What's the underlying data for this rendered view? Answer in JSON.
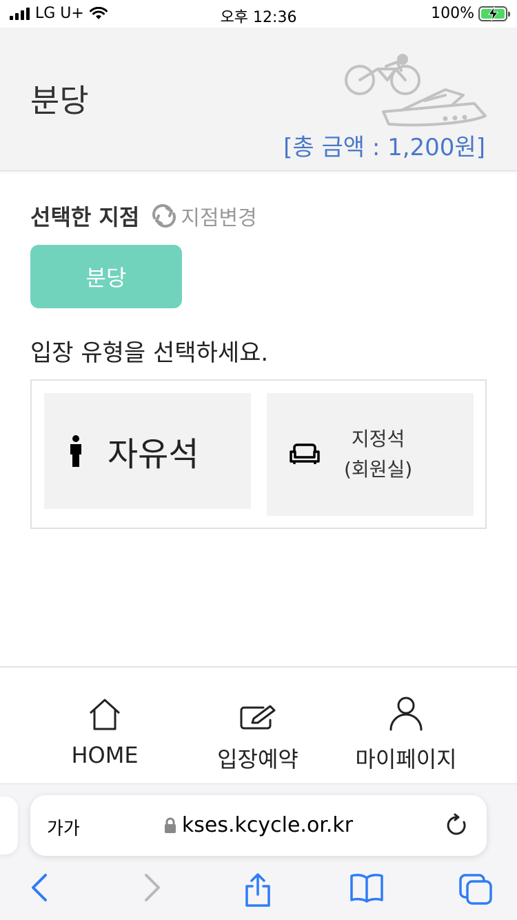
{
  "status_bar": {
    "carrier": "LG U+",
    "time": "오후 12:36",
    "battery": "100%"
  },
  "header": {
    "title": "분당",
    "total_amount": "[총 금액 : 1,200원]"
  },
  "branch": {
    "heading": "선택한 지점",
    "change_label": "지점변경",
    "selected": "분당"
  },
  "entry": {
    "prompt": "입장 유형을 선택하세요.",
    "free_seat": "자유석",
    "reserved_line1": "지정석",
    "reserved_line2": "(회원실)"
  },
  "bottom_nav": {
    "home": "HOME",
    "reserve": "입장예약",
    "mypage": "마이페이지"
  },
  "browser": {
    "text_size": "가가",
    "url": "kses.kcycle.or.kr"
  },
  "colors": {
    "accent_teal": "#72d3bd",
    "amount_blue": "#4a78c9",
    "safari_blue": "#2f7cf6"
  },
  "icons": [
    "signal-icon",
    "wifi-icon",
    "battery-icon",
    "cycling-boat-illustration",
    "refresh-icon",
    "person-icon",
    "sofa-icon",
    "home-icon",
    "edit-icon",
    "user-icon",
    "lock-icon",
    "reload-icon",
    "back-icon",
    "forward-icon",
    "share-icon",
    "bookmarks-icon",
    "tabs-icon"
  ]
}
